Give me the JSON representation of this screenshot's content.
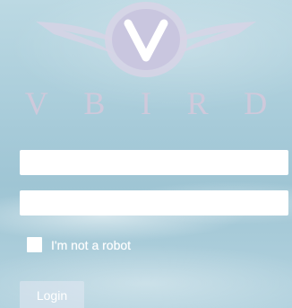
{
  "brand": {
    "letters": [
      "V",
      "B",
      "I",
      "R",
      "D"
    ]
  },
  "form": {
    "username": {
      "value": "",
      "placeholder": ""
    },
    "password": {
      "value": "",
      "placeholder": ""
    },
    "captcha_label": "I'm not a robot",
    "login_label": "Login"
  },
  "colors": {
    "brand_letter": "#d6c8da",
    "logo_fill": "#d9d3e6",
    "button_bg": "#e1e8f2",
    "field_bg": "#ffffff"
  },
  "icons": {
    "logo": "vbird-winged-v-logo",
    "captcha": "checkbox-icon"
  }
}
